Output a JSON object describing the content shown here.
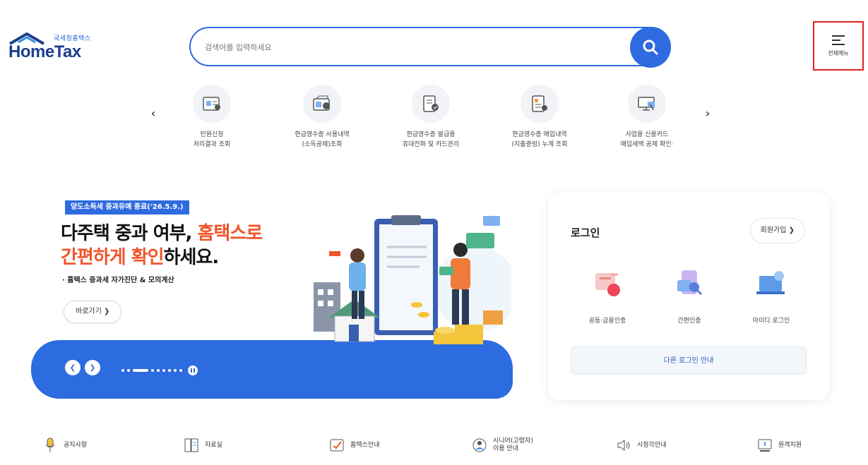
{
  "header": {
    "logo_small": "국세청홈택스",
    "logo_big": "HomeTax",
    "search_placeholder": "검색어를 입력하세요",
    "menu_label": "전체메뉴"
  },
  "quick_services": [
    {
      "label": "민원신청\n처리결과 조회",
      "icon": "document-status-icon"
    },
    {
      "label": "현금영수증 사용내역\n(소득공제)조회",
      "icon": "receipt-card-icon"
    },
    {
      "label": "현금영수증 발급용\n휴대전화 및 카드관리",
      "icon": "receipt-phone-icon"
    },
    {
      "label": "현금영수증 매입내역\n(지출증빙) 누계 조회",
      "icon": "receipt-list-icon"
    },
    {
      "label": "사업용 신용카드\n매입세액 공제 확인·",
      "icon": "business-card-icon"
    }
  ],
  "banner": {
    "tag": "양도소득세 중과유예 종료('26.5.9.)",
    "title_line1_plain": "다주택 중과 여부, ",
    "title_line1_highlight": "홈택스로",
    "title_line2_highlight": "간편하게 확인",
    "title_line2_plain": "하세요.",
    "subtitle": "· 홈택스 중과세 자가진단 & 모의계산",
    "go_button": "바로가기 ❯"
  },
  "login": {
    "title": "로그인",
    "signup": "회원가입 ❯",
    "methods": [
      {
        "label": "공동·금융인증",
        "icon": "certificate-icon"
      },
      {
        "label": "간편인증",
        "icon": "simple-auth-icon"
      },
      {
        "label": "아이디 로그인",
        "icon": "id-login-icon"
      }
    ],
    "other": "다른 로그인 안내"
  },
  "bottom_links": [
    {
      "label": "공지사항",
      "icon": "microphone-icon"
    },
    {
      "label": "자료실",
      "icon": "archive-icon"
    },
    {
      "label": "홈택스안내",
      "icon": "guide-icon"
    },
    {
      "label": "시니어(고령자)\n이용 안내",
      "icon": "senior-icon"
    },
    {
      "label": "시청각안내",
      "icon": "speaker-icon"
    },
    {
      "label": "원격지원",
      "icon": "remote-support-icon"
    }
  ],
  "colors": {
    "primary": "#2f6be0",
    "highlight": "#f0552b",
    "menu_border": "#e41f1f"
  }
}
